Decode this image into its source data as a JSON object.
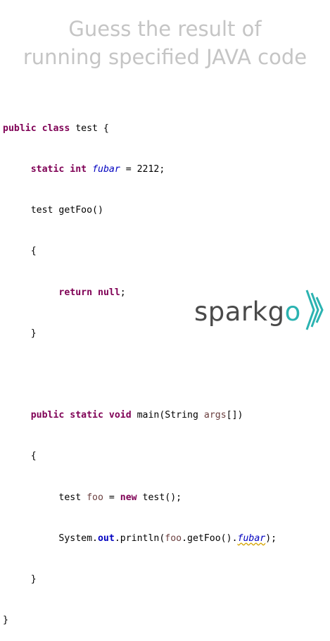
{
  "header": {
    "title_line_1": "Guess the result of",
    "title_line_2": "running specified JAVA code"
  },
  "code": {
    "kw_public": "public",
    "kw_class": "class",
    "class_name": " test {",
    "kw_static": "static",
    "kw_int": "int",
    "field_name": "fubar",
    "field_init": " = 2212;",
    "method_sig": "test getFoo()",
    "open_brace": "{",
    "close_brace": "}",
    "kw_return": "return",
    "kw_null": "null",
    "semicolon": ";",
    "kw_void": "void",
    "main_sig": " main(String ",
    "args_name": "args",
    "main_tail": "[])",
    "local_type": "test ",
    "local_name": "foo",
    "assign": " = ",
    "kw_new": "new",
    "ctor_call": " test();",
    "system": "System.",
    "out": "out",
    "println_open": ".println(",
    "getfoo_call": ".getFoo().",
    "print_tail": ");"
  },
  "logo": {
    "text_prefix": "spark",
    "text_g": "g",
    "text_o": "o",
    "icon": "triple-chevron-right-icon",
    "accent_color": "#2bb3b1"
  }
}
